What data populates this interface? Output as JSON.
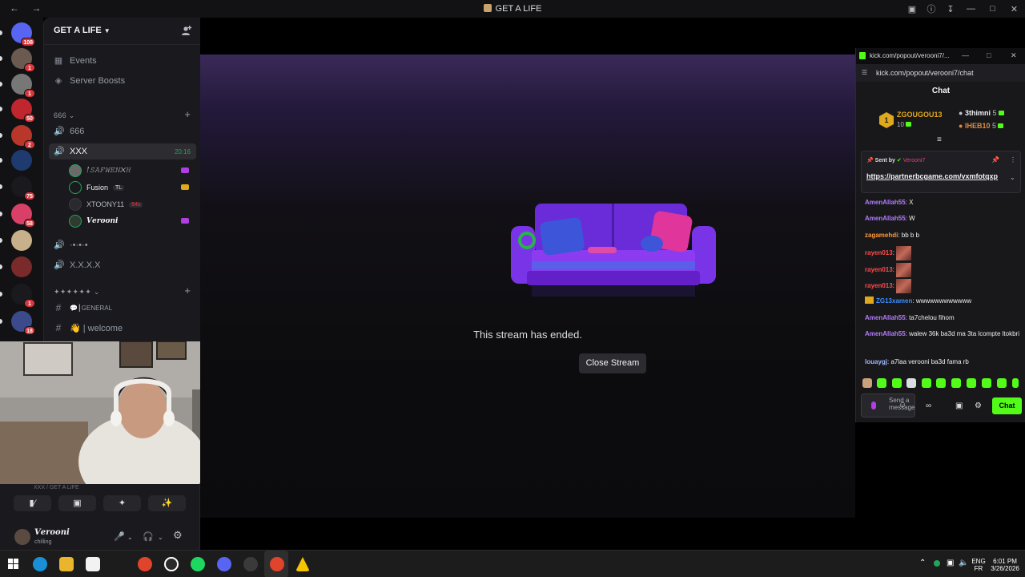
{
  "window": {
    "title": "GET A LIFE",
    "nav": "← →"
  },
  "rail": {
    "servers": [
      {
        "badge": "108",
        "color": "#5865f2"
      },
      {
        "badge": "1",
        "color": "#6b5a50"
      },
      {
        "badge": "1",
        "color": "#777777"
      },
      {
        "badge": "50",
        "color": "#c0262e"
      },
      {
        "badge": "2",
        "color": "#b8362a"
      },
      {
        "badge": "",
        "color": "#1f3a6e"
      },
      {
        "badge": "75",
        "color": "#1a1a1e"
      },
      {
        "badge": "58",
        "color": "#d84068"
      },
      {
        "badge": "",
        "color": "#c7b08a"
      },
      {
        "badge": "",
        "color": "#7a2a2a"
      },
      {
        "badge": "1",
        "color": "#1a1a1e"
      },
      {
        "badge": "18",
        "color": "#3a4a8a"
      }
    ]
  },
  "sidebar": {
    "guild_name": "GET A LIFE",
    "events": "Events",
    "boosts": "Server Boosts",
    "category1": "666",
    "voice_666": "666",
    "voice_xxx": "XXX",
    "voice_xxx_time": "20:16",
    "voice_users": [
      {
        "name": "!𝚂𝙰𝙵𝚆𝙴𝙽✕𝙷",
        "tag": ""
      },
      {
        "name": "Fusion",
        "tag": "TL"
      },
      {
        "name": "XTOONY11",
        "tag": "64s"
      },
      {
        "name": "𝑽𝒆𝒓𝒐𝒐𝒏𝒊",
        "tag": ""
      }
    ],
    "voice_dots": "·•·•·•",
    "voice_xxxx": "X.X.X.X",
    "category2": "✦✦✦✦✦✦",
    "text_general": "💬┃GENERAL",
    "text_welcome": "👋 | welcome"
  },
  "user_panel": {
    "voice_line": "XXX / GET A LIFE",
    "name": "𝑽𝒆𝒓𝒐𝒐𝒏𝒊",
    "status": "chilling"
  },
  "stream": {
    "ended_text": "This stream has ended.",
    "close_label": "Close Stream"
  },
  "chat": {
    "window_title": "kick.com/popout/verooni7/...",
    "url": "kick.com/popout/verooni7/chat",
    "heading": "Chat",
    "leaderboard": {
      "first_name": "ZGOUGOU13",
      "first_count": "10",
      "second_name": "3thimni",
      "second_count": "5",
      "third_name": "IHEB10",
      "third_count": "5"
    },
    "pinned": {
      "sent_by": "Sent by",
      "sender": "Verooni7",
      "link": "https://partnerbcgame.com/vxmfotqxp"
    },
    "messages": [
      {
        "user": "AmenAllah55",
        "text": "X",
        "color": "#b57bff"
      },
      {
        "user": "AmenAllah55",
        "text": "W",
        "color": "#b57bff"
      },
      {
        "user": "zagamehdi",
        "text": "bb b b",
        "color": "#ff9a3c"
      },
      {
        "user": "rayen013",
        "text": "",
        "color": "#ff4b4b"
      },
      {
        "user": "rayen013",
        "text": "",
        "color": "#ff4b4b"
      },
      {
        "user": "rayen013",
        "text": "",
        "color": "#ff4b4b"
      },
      {
        "user": "ZG13xamen",
        "text": "wwwwwwwwwwww",
        "color": "#3c8dff"
      },
      {
        "user": "AmenAllah55",
        "text": "ta7chelou fihom",
        "color": "#b57bff"
      },
      {
        "user": "AmenAllah55",
        "text": "walew 36k ba3d ma 3ta lcompte ltokbri",
        "color": "#b57bff"
      },
      {
        "user": "louaygj",
        "text": "a7laa verooni ba3d fama rb",
        "color": "#9fb8ff"
      }
    ],
    "input_placeholder": "Send a message",
    "send_label": "Chat"
  },
  "taskbar": {
    "lang_top": "ENG",
    "lang_bottom": "FR",
    "time": "6:01 PM",
    "date": "3/26/2026"
  }
}
